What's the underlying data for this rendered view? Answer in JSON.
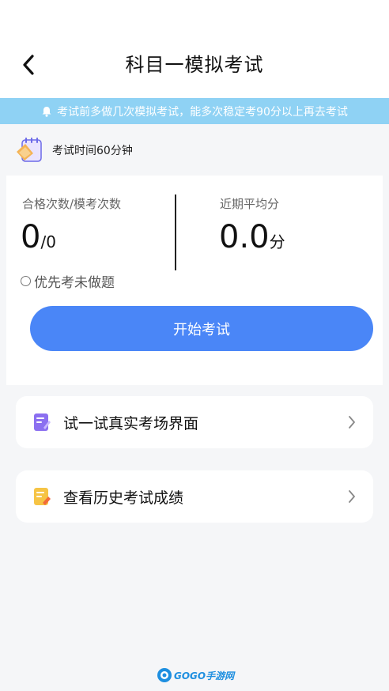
{
  "header": {
    "title": "科目一模拟考试"
  },
  "notice": {
    "text": "考试前多做几次模拟考试，能多次稳定考90分以上再去考试"
  },
  "exam_time": {
    "text": "考试时间60分钟"
  },
  "stats": {
    "pass_label": "合格次数/模考次数",
    "pass_count": "0",
    "pass_total": "/0",
    "avg_label": "近期平均分",
    "avg_value": "0.0",
    "avg_unit": "分",
    "priority_label": "优先考未做题"
  },
  "start_button": {
    "label": "开始考试"
  },
  "menu": {
    "items": [
      {
        "label": "试一试真实考场界面",
        "icon": "edit-document-icon",
        "color": "#8b6ff0"
      },
      {
        "label": "查看历史考试成绩",
        "icon": "document-score-icon",
        "color": "#f6c445"
      }
    ]
  },
  "watermark": {
    "text": "GOGO手游网"
  },
  "colors": {
    "accent": "#4a86f7",
    "notice_bg": "#8fd2f4"
  }
}
